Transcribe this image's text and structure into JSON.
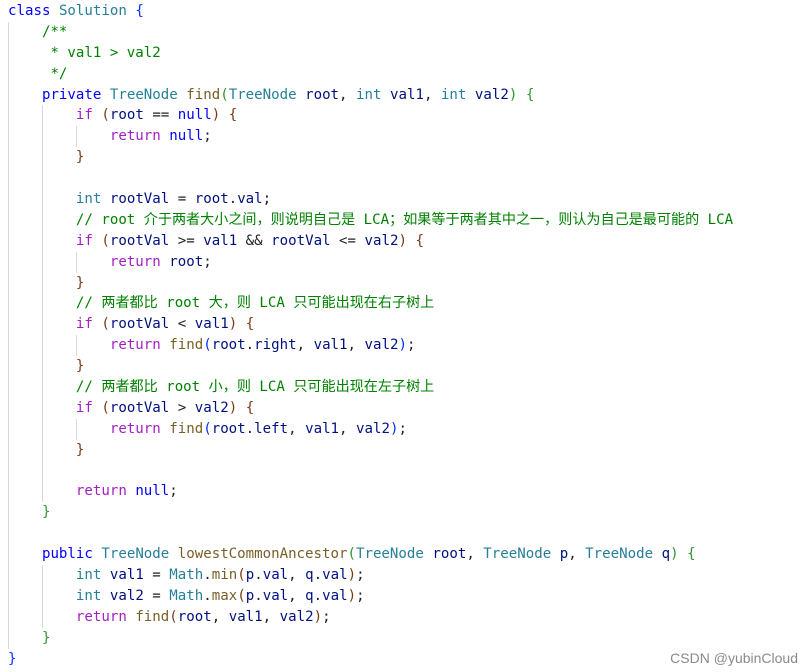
{
  "editor": {
    "language": "java",
    "lines": [
      {
        "indent": 0,
        "tokens": [
          [
            "decl",
            "class"
          ],
          [
            "",
            " "
          ],
          [
            "ty",
            "Solution"
          ],
          [
            "",
            " "
          ],
          [
            "br1",
            "{"
          ]
        ]
      },
      {
        "indent": 1,
        "tokens": [
          [
            "cm",
            "/**"
          ]
        ]
      },
      {
        "indent": 1,
        "tokens": [
          [
            "cm",
            " * val1 > val2"
          ]
        ]
      },
      {
        "indent": 1,
        "tokens": [
          [
            "cm",
            " */"
          ]
        ]
      },
      {
        "indent": 1,
        "tokens": [
          [
            "decl",
            "private"
          ],
          [
            "",
            " "
          ],
          [
            "ty",
            "TreeNode"
          ],
          [
            "",
            " "
          ],
          [
            "fn",
            "find"
          ],
          [
            "br2",
            "("
          ],
          [
            "ty",
            "TreeNode"
          ],
          [
            "",
            " "
          ],
          [
            "var",
            "root"
          ],
          [
            "",
            ", "
          ],
          [
            "ty",
            "int"
          ],
          [
            "",
            " "
          ],
          [
            "var",
            "val1"
          ],
          [
            "",
            ", "
          ],
          [
            "ty",
            "int"
          ],
          [
            "",
            " "
          ],
          [
            "var",
            "val2"
          ],
          [
            "br2",
            ")"
          ],
          [
            "",
            " "
          ],
          [
            "br2",
            "{"
          ]
        ]
      },
      {
        "indent": 2,
        "tokens": [
          [
            "kw",
            "if"
          ],
          [
            "",
            " "
          ],
          [
            "br3",
            "("
          ],
          [
            "var",
            "root"
          ],
          [
            "",
            " == "
          ],
          [
            "nl",
            "null"
          ],
          [
            "br3",
            ")"
          ],
          [
            "",
            " "
          ],
          [
            "br3",
            "{"
          ]
        ]
      },
      {
        "indent": 3,
        "tokens": [
          [
            "kw",
            "return"
          ],
          [
            "",
            " "
          ],
          [
            "nl",
            "null"
          ],
          [
            "",
            ";"
          ]
        ]
      },
      {
        "indent": 2,
        "tokens": [
          [
            "br3",
            "}"
          ]
        ]
      },
      {
        "indent": 0,
        "tokens": []
      },
      {
        "indent": 2,
        "tokens": [
          [
            "ty",
            "int"
          ],
          [
            "",
            " "
          ],
          [
            "var",
            "rootVal"
          ],
          [
            "",
            " = "
          ],
          [
            "var",
            "root"
          ],
          [
            "",
            "."
          ],
          [
            "var",
            "val"
          ],
          [
            "",
            ";"
          ]
        ]
      },
      {
        "indent": 2,
        "tokens": [
          [
            "cm",
            "// root 介于两者大小之间，则说明自己是 LCA；如果等于两者其中之一，则认为自己是最可能的 LCA"
          ]
        ]
      },
      {
        "indent": 2,
        "tokens": [
          [
            "kw",
            "if"
          ],
          [
            "",
            " "
          ],
          [
            "br3",
            "("
          ],
          [
            "var",
            "rootVal"
          ],
          [
            "",
            " >= "
          ],
          [
            "var",
            "val1"
          ],
          [
            "",
            " && "
          ],
          [
            "var",
            "rootVal"
          ],
          [
            "",
            " <= "
          ],
          [
            "var",
            "val2"
          ],
          [
            "br3",
            ")"
          ],
          [
            "",
            " "
          ],
          [
            "br3",
            "{"
          ]
        ]
      },
      {
        "indent": 3,
        "tokens": [
          [
            "kw",
            "return"
          ],
          [
            "",
            " "
          ],
          [
            "var",
            "root"
          ],
          [
            "",
            ";"
          ]
        ]
      },
      {
        "indent": 2,
        "tokens": [
          [
            "br3",
            "}"
          ]
        ]
      },
      {
        "indent": 2,
        "tokens": [
          [
            "cm",
            "// 两者都比 root 大，则 LCA 只可能出现在右子树上"
          ]
        ]
      },
      {
        "indent": 2,
        "tokens": [
          [
            "kw",
            "if"
          ],
          [
            "",
            " "
          ],
          [
            "br3",
            "("
          ],
          [
            "var",
            "rootVal"
          ],
          [
            "",
            " < "
          ],
          [
            "var",
            "val1"
          ],
          [
            "br3",
            ")"
          ],
          [
            "",
            " "
          ],
          [
            "br3",
            "{"
          ]
        ]
      },
      {
        "indent": 3,
        "tokens": [
          [
            "kw",
            "return"
          ],
          [
            "",
            " "
          ],
          [
            "fn",
            "find"
          ],
          [
            "br1",
            "("
          ],
          [
            "var",
            "root"
          ],
          [
            "",
            "."
          ],
          [
            "var",
            "right"
          ],
          [
            "",
            ", "
          ],
          [
            "var",
            "val1"
          ],
          [
            "",
            ", "
          ],
          [
            "var",
            "val2"
          ],
          [
            "br1",
            ")"
          ],
          [
            "",
            ";"
          ]
        ]
      },
      {
        "indent": 2,
        "tokens": [
          [
            "br3",
            "}"
          ]
        ]
      },
      {
        "indent": 2,
        "tokens": [
          [
            "cm",
            "// 两者都比 root 小，则 LCA 只可能出现在左子树上"
          ]
        ]
      },
      {
        "indent": 2,
        "tokens": [
          [
            "kw",
            "if"
          ],
          [
            "",
            " "
          ],
          [
            "br3",
            "("
          ],
          [
            "var",
            "rootVal"
          ],
          [
            "",
            " > "
          ],
          [
            "var",
            "val2"
          ],
          [
            "br3",
            ")"
          ],
          [
            "",
            " "
          ],
          [
            "br3",
            "{"
          ]
        ]
      },
      {
        "indent": 3,
        "tokens": [
          [
            "kw",
            "return"
          ],
          [
            "",
            " "
          ],
          [
            "fn",
            "find"
          ],
          [
            "br1",
            "("
          ],
          [
            "var",
            "root"
          ],
          [
            "",
            "."
          ],
          [
            "var",
            "left"
          ],
          [
            "",
            ", "
          ],
          [
            "var",
            "val1"
          ],
          [
            "",
            ", "
          ],
          [
            "var",
            "val2"
          ],
          [
            "br1",
            ")"
          ],
          [
            "",
            ";"
          ]
        ]
      },
      {
        "indent": 2,
        "tokens": [
          [
            "br3",
            "}"
          ]
        ]
      },
      {
        "indent": 0,
        "tokens": []
      },
      {
        "indent": 2,
        "tokens": [
          [
            "kw",
            "return"
          ],
          [
            "",
            " "
          ],
          [
            "nl",
            "null"
          ],
          [
            "",
            ";"
          ]
        ]
      },
      {
        "indent": 1,
        "tokens": [
          [
            "br2",
            "}"
          ]
        ]
      },
      {
        "indent": 0,
        "tokens": []
      },
      {
        "indent": 1,
        "tokens": [
          [
            "decl",
            "public"
          ],
          [
            "",
            " "
          ],
          [
            "ty",
            "TreeNode"
          ],
          [
            "",
            " "
          ],
          [
            "fn",
            "lowestCommonAncestor"
          ],
          [
            "br2",
            "("
          ],
          [
            "ty",
            "TreeNode"
          ],
          [
            "",
            " "
          ],
          [
            "var",
            "root"
          ],
          [
            "",
            ", "
          ],
          [
            "ty",
            "TreeNode"
          ],
          [
            "",
            " "
          ],
          [
            "var",
            "p"
          ],
          [
            "",
            ", "
          ],
          [
            "ty",
            "TreeNode"
          ],
          [
            "",
            " "
          ],
          [
            "var",
            "q"
          ],
          [
            "br2",
            ")"
          ],
          [
            "",
            " "
          ],
          [
            "br2",
            "{"
          ]
        ]
      },
      {
        "indent": 2,
        "tokens": [
          [
            "ty",
            "int"
          ],
          [
            "",
            " "
          ],
          [
            "var",
            "val1"
          ],
          [
            "",
            " = "
          ],
          [
            "ty",
            "Math"
          ],
          [
            "",
            "."
          ],
          [
            "fn",
            "min"
          ],
          [
            "br3",
            "("
          ],
          [
            "var",
            "p"
          ],
          [
            "",
            "."
          ],
          [
            "var",
            "val"
          ],
          [
            "",
            ", "
          ],
          [
            "var",
            "q"
          ],
          [
            "",
            "."
          ],
          [
            "var",
            "val"
          ],
          [
            "br3",
            ")"
          ],
          [
            "",
            ";"
          ]
        ]
      },
      {
        "indent": 2,
        "tokens": [
          [
            "ty",
            "int"
          ],
          [
            "",
            " "
          ],
          [
            "var",
            "val2"
          ],
          [
            "",
            " = "
          ],
          [
            "ty",
            "Math"
          ],
          [
            "",
            "."
          ],
          [
            "fn",
            "max"
          ],
          [
            "br3",
            "("
          ],
          [
            "var",
            "p"
          ],
          [
            "",
            "."
          ],
          [
            "var",
            "val"
          ],
          [
            "",
            ", "
          ],
          [
            "var",
            "q"
          ],
          [
            "",
            "."
          ],
          [
            "var",
            "val"
          ],
          [
            "br3",
            ")"
          ],
          [
            "",
            ";"
          ]
        ]
      },
      {
        "indent": 2,
        "tokens": [
          [
            "kw",
            "return"
          ],
          [
            "",
            " "
          ],
          [
            "fn",
            "find"
          ],
          [
            "br3",
            "("
          ],
          [
            "var",
            "root"
          ],
          [
            "",
            ", "
          ],
          [
            "var",
            "val1"
          ],
          [
            "",
            ", "
          ],
          [
            "var",
            "val2"
          ],
          [
            "br3",
            ")"
          ],
          [
            "",
            ";"
          ]
        ]
      },
      {
        "indent": 1,
        "tokens": [
          [
            "br2",
            "}"
          ]
        ]
      },
      {
        "indent": 0,
        "tokens": [
          [
            "br1",
            "}"
          ]
        ]
      }
    ]
  },
  "watermark": "CSDN @yubinCloud"
}
